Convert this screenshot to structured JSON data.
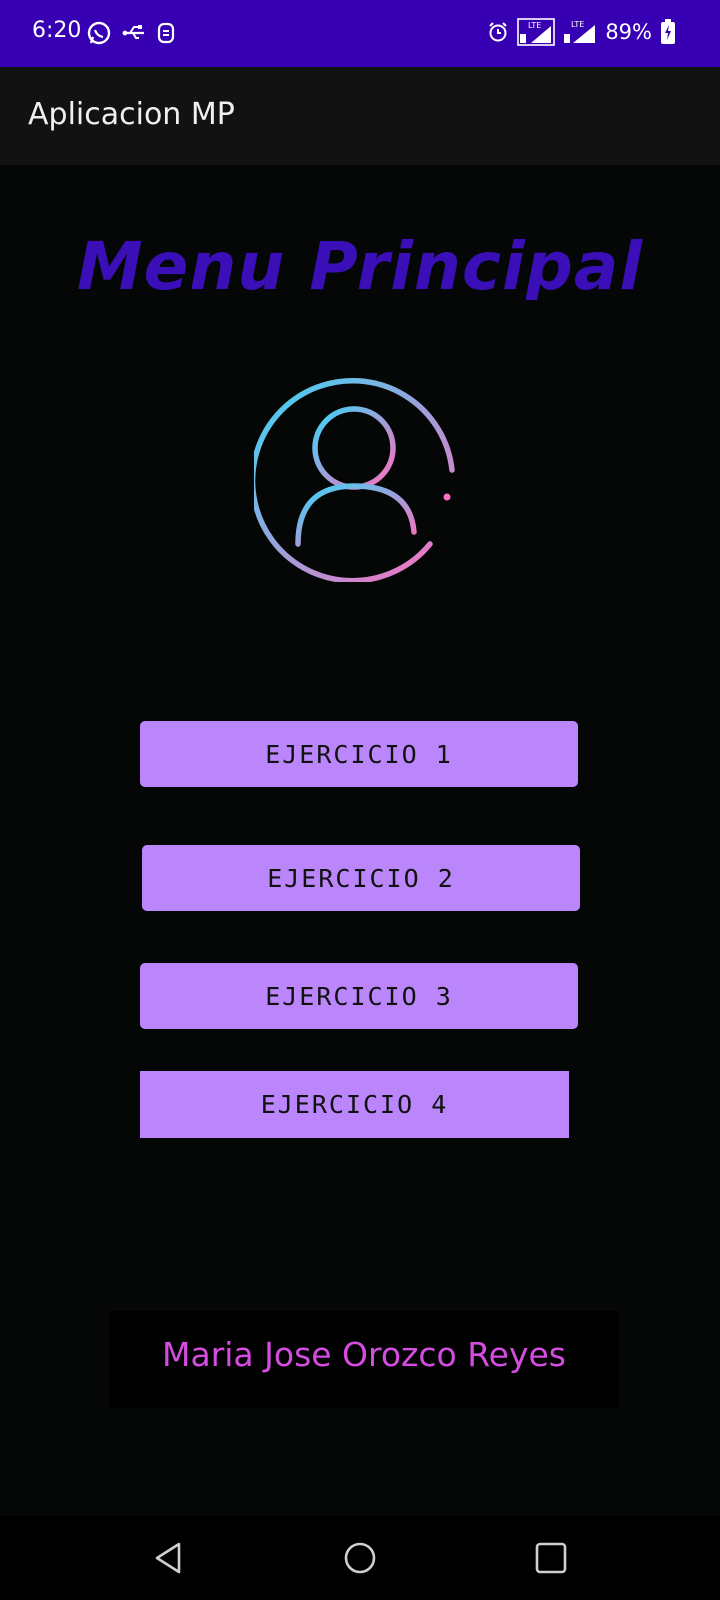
{
  "status_bar": {
    "time": "6:20",
    "battery": "89%",
    "icons": [
      "whatsapp-icon",
      "usb-icon",
      "notification-icon",
      "alarm-icon",
      "lte-signal-icon",
      "lte-signal-icon",
      "battery-charging-icon"
    ],
    "background": "#3700b3"
  },
  "app_bar": {
    "title": "Aplicacion MP"
  },
  "main": {
    "heading": "Menu Principal",
    "heading_color": "#3a0fb7",
    "avatar_icon": "user-profile-icon",
    "buttons": [
      {
        "label": "EJERCICIO 1"
      },
      {
        "label": "EJERCICIO 2"
      },
      {
        "label": "EJERCICIO 3"
      },
      {
        "label": "EJERCICIO 4"
      }
    ],
    "button_color": "#bb86fc",
    "author": "Maria Jose Orozco Reyes",
    "author_color": "#d54ce0"
  },
  "nav_bar": {
    "icons": [
      "back-icon",
      "home-icon",
      "recents-icon"
    ]
  }
}
